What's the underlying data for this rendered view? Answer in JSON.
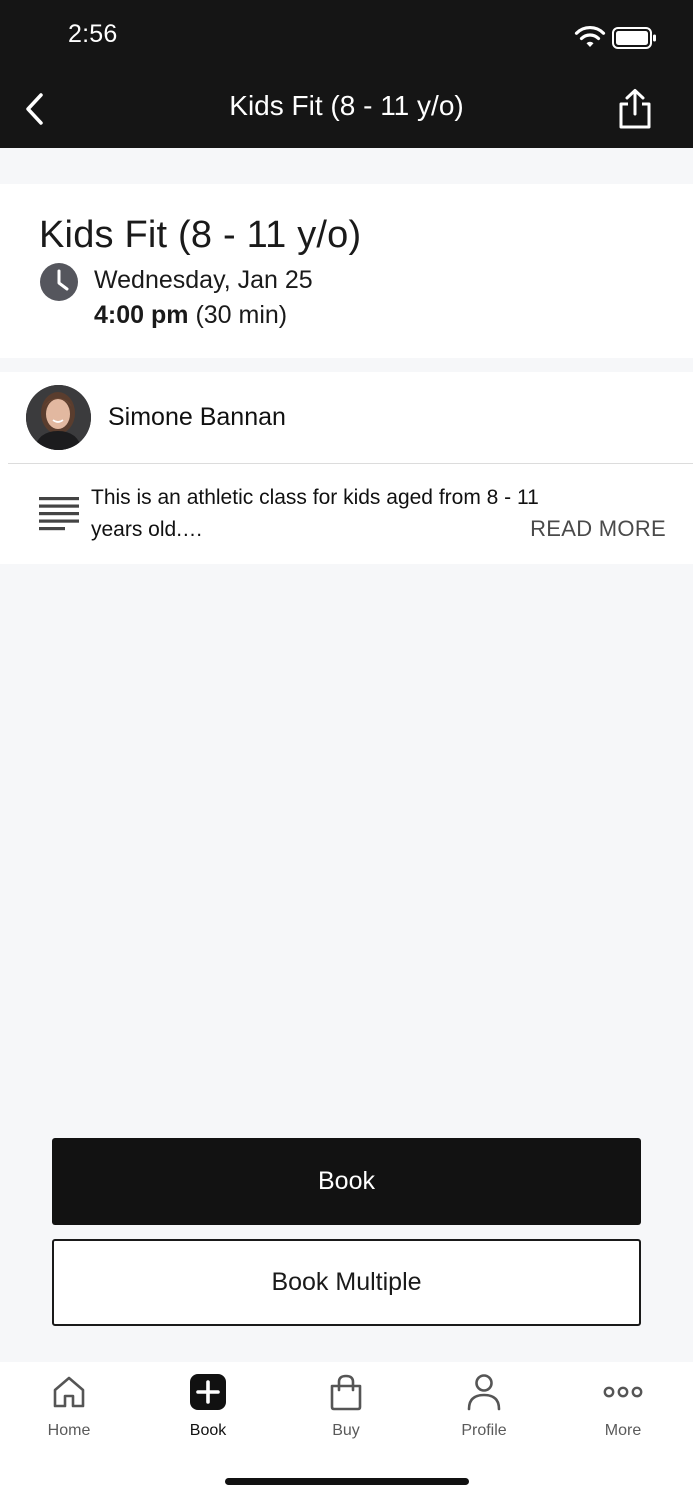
{
  "status_bar": {
    "time": "2:56"
  },
  "header": {
    "title": "Kids Fit (8 - 11 y/o)",
    "back_icon": "chevron-left-icon",
    "share_icon": "share-icon"
  },
  "class_info": {
    "title": "Kids Fit (8 - 11 y/o)",
    "date": "Wednesday, Jan 25",
    "time": "4:00 pm",
    "duration": "(30 min)"
  },
  "instructor": {
    "name": "Simone Bannan"
  },
  "description": {
    "text": "This is an athletic class for kids aged from 8 - 11 years old.…",
    "read_more": "READ MORE"
  },
  "actions": {
    "book": "Book",
    "book_multiple": "Book Multiple"
  },
  "tabs": [
    {
      "label": "Home",
      "icon": "home-icon",
      "active": false
    },
    {
      "label": "Book",
      "icon": "plus-square-icon",
      "active": true
    },
    {
      "label": "Buy",
      "icon": "shopping-bag-icon",
      "active": false
    },
    {
      "label": "Profile",
      "icon": "person-icon",
      "active": false
    },
    {
      "label": "More",
      "icon": "more-dots-icon",
      "active": false
    }
  ],
  "colors": {
    "header_bg": "#151515",
    "primary_button": "#121212",
    "background": "#f6f7f9"
  }
}
